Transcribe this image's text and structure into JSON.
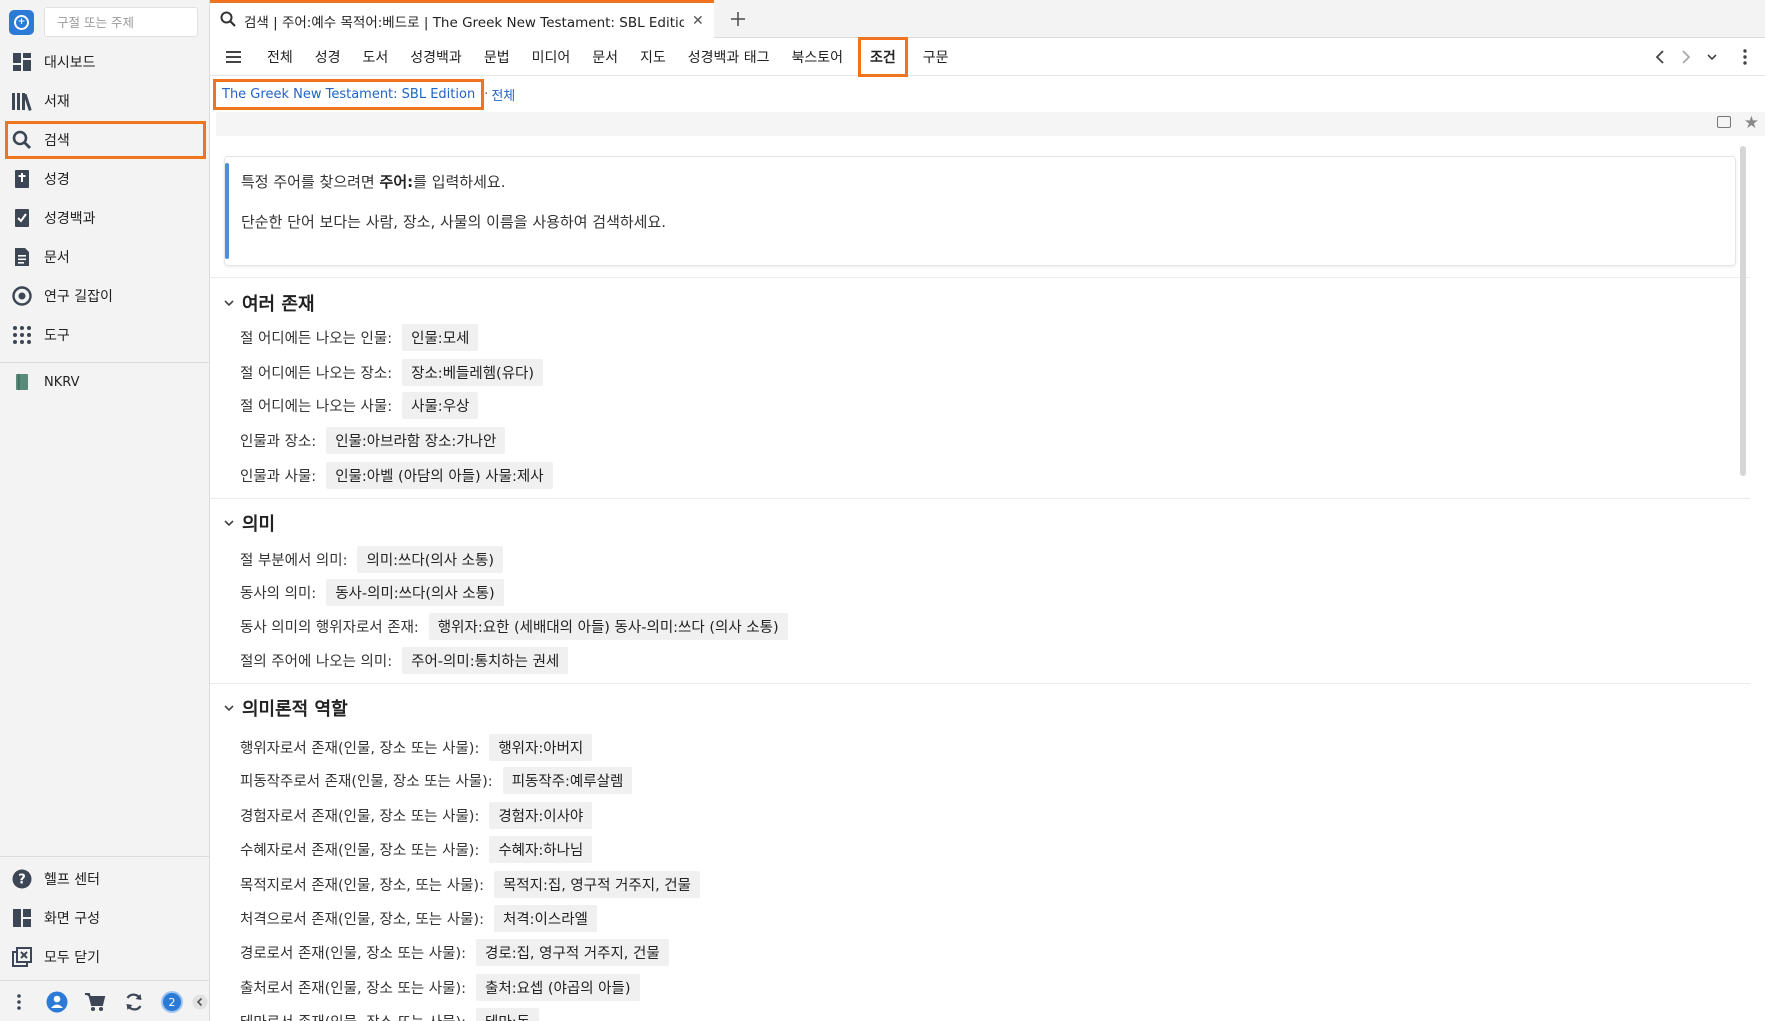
{
  "sidebar": {
    "search_placeholder": "구절 또는 주제",
    "items": [
      {
        "label": "대시보드",
        "icon": "dashboard-icon"
      },
      {
        "label": "서재",
        "icon": "library-icon"
      },
      {
        "label": "검색",
        "icon": "search-icon"
      },
      {
        "label": "성경",
        "icon": "bible-icon"
      },
      {
        "label": "성경백과",
        "icon": "factbook-icon"
      },
      {
        "label": "문서",
        "icon": "document-icon"
      },
      {
        "label": "연구 길잡이",
        "icon": "guide-icon"
      },
      {
        "label": "도구",
        "icon": "tools-icon"
      },
      {
        "label": "NKRV",
        "icon": "book-icon"
      }
    ],
    "footer": [
      {
        "label": "헬프 센터",
        "icon": "help-icon"
      },
      {
        "label": "화면 구성",
        "icon": "layout-icon"
      },
      {
        "label": "모두 닫기",
        "icon": "close-all-icon"
      }
    ],
    "sync_badge": "2"
  },
  "tab": {
    "title": "검색 | 주어:예수 목적어:베드로 | The Greek New Testament: SBL Edition, 전체"
  },
  "categories": [
    "전체",
    "성경",
    "도서",
    "성경백과",
    "문법",
    "미디어",
    "문서",
    "지도",
    "성경백과 태그",
    "북스토어",
    "조건",
    "구문"
  ],
  "active_category": "조건",
  "breadcrumb": {
    "book": "The Greek New Testament: SBL Edition",
    "separator": "·",
    "scope": "전체"
  },
  "tip": {
    "line1_pre": "특정 주어를 찾으려면 ",
    "line1_bold": "주어:",
    "line1_post": "를 입력하세요.",
    "line2": "단순한 단어 보다는 사람, 장소, 사물의 이름을 사용하여 검색하세요."
  },
  "sections": {
    "entities": {
      "title": "여러 존재",
      "rows": [
        {
          "label": "절 어디에든 나오는 인물:",
          "example": "인물:모세"
        },
        {
          "label": "절 어디에든 나오는 장소:",
          "example": "장소:베들레헴(유다)"
        },
        {
          "label": "절 어디에는 나오는 사물:",
          "example": "사물:우상"
        },
        {
          "label": "인물과 장소:",
          "example": "인물:아브라함 장소:가나안"
        },
        {
          "label": "인물과 사물:",
          "example": "인물:아벨 (아담의 아들) 사물:제사"
        }
      ]
    },
    "sense": {
      "title": "의미",
      "rows": [
        {
          "label": "절 부분에서 의미:",
          "example": "의미:쓰다(의사 소통)"
        },
        {
          "label": "동사의 의미:",
          "example": "동사-의미:쓰다(의사 소통)"
        },
        {
          "label": "동사 의미의 행위자로서 존재:",
          "example": "행위자:요한 (세배대의 아들) 동사-의미:쓰다 (의사 소통)"
        },
        {
          "label": "절의 주어에 나오는 의미:",
          "example": "주어-의미:통치하는 권세"
        }
      ]
    },
    "roles": {
      "title": "의미론적 역할",
      "rows": [
        {
          "label": "행위자로서 존재(인물, 장소 또는 사물):",
          "example": "행위자:아버지"
        },
        {
          "label": "피동작주로서 존재(인물, 장소 또는 사물):",
          "example": "피동작주:예루살렘"
        },
        {
          "label": "경험자로서 존재(인물, 장소 또는 사물):",
          "example": "경험자:이사야"
        },
        {
          "label": "수혜자로서 존재(인물, 장소 또는 사물):",
          "example": "수혜자:하나님"
        },
        {
          "label": "목적지로서 존재(인물, 장소, 또는 사물):",
          "example": "목적지:집, 영구적 거주지, 건물"
        },
        {
          "label": "처격으로서 존재(인물, 장소, 또는 사물):",
          "example": "처격:이스라엘"
        },
        {
          "label": "경로로서 존재(인물, 장소 또는 사물):",
          "example": "경로:집, 영구적 거주지, 건물"
        },
        {
          "label": "출처로서 존재(인물, 장소 또는 사물):",
          "example": "출처:요셉 (야곱의 아들)"
        },
        {
          "label": "테마로서 존재(인물, 장소 또는 사물):",
          "example": "테마:돈"
        }
      ]
    }
  }
}
